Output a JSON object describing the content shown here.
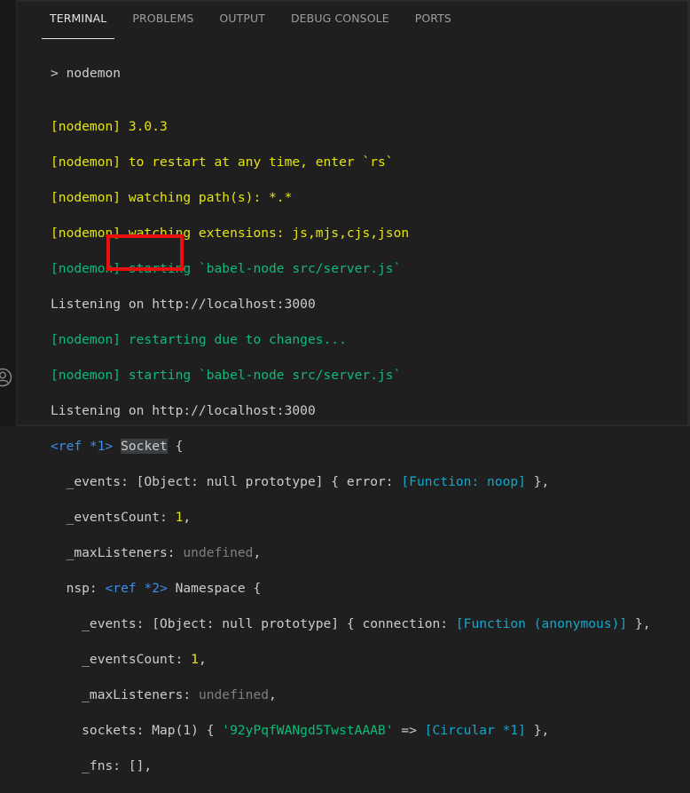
{
  "tabs": [
    {
      "label": "TERMINAL",
      "active": true
    },
    {
      "label": "PROBLEMS",
      "active": false
    },
    {
      "label": "OUTPUT",
      "active": false
    },
    {
      "label": "DEBUG CONSOLE",
      "active": false
    },
    {
      "label": "PORTS",
      "active": false
    }
  ],
  "terminal": {
    "command": "> nodemon",
    "lines": {
      "l1": "[nodemon] 3.0.3",
      "l2": "[nodemon] to restart at any time, enter `rs`",
      "l3": "[nodemon] watching path(s): *.*",
      "l4": "[nodemon] watching extensions: js,mjs,cjs,json",
      "l5": "[nodemon] starting `babel-node src/server.js`",
      "l6": "Listening on http://localhost:3000",
      "l7": "[nodemon] restarting due to changes...",
      "l8": "[nodemon] starting `babel-node src/server.js`",
      "l9": "Listening on http://localhost:3000",
      "ref1": "<ref *1>",
      "socket": "Socket",
      "brace": " {",
      "events_key": "  _events: [Object: null prototype] { error: ",
      "events_fn": "[Function: noop]",
      "events_end": " },",
      "evcount_key": "  _eventsCount: ",
      "evcount_val": "1",
      "maxl_key": "  _maxListeners: ",
      "maxl_val": "undefined",
      "nsp_key": "  nsp: ",
      "ref2": "<ref *2>",
      "nsp_name": " Namespace {",
      "n_events_key": "    _events: [Object: null prototype] { connection: ",
      "n_events_fn": "[Function (anonymous)]",
      "n_events_end": " },",
      "n_evcount_key": "    _eventsCount: ",
      "n_evcount_val": "1",
      "n_maxl_key": "    _maxListeners: ",
      "n_maxl_val": "undefined",
      "sockets_key": "    sockets: Map(1) { ",
      "sockets_id": "'92yPqfWANgd5TwstAAAB'",
      "sockets_arrow": " => ",
      "sockets_circ": "[Circular *1]",
      "sockets_end": " },",
      "fns": "    _fns: [],"
    }
  },
  "colors": {
    "background": "#1f1f1f",
    "yellow": "#e5e510",
    "green": "#0dbc79",
    "blue": "#3b8eea",
    "highlight_box": "#e8100f"
  },
  "icons": [
    "account-icon"
  ]
}
